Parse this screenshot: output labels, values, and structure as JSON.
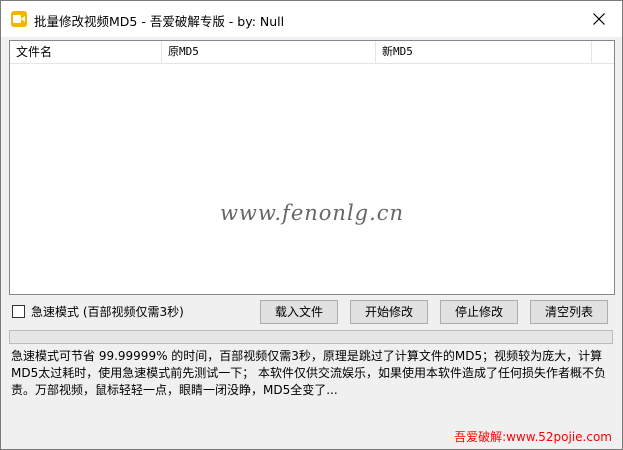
{
  "window": {
    "title": "批量修改视频MD5 - 吾爱破解专版 - by: Null"
  },
  "list": {
    "columns": [
      "文件名",
      "原MD5",
      "新MD5"
    ],
    "rows": []
  },
  "watermark": "www.fenonlg.cn",
  "options": {
    "fast_mode_label": "急速模式 (百部视频仅需3秒)",
    "fast_mode_checked": false
  },
  "buttons": {
    "load": "载入文件",
    "start": "开始修改",
    "stop": "停止修改",
    "clear": "清空列表"
  },
  "progress": {
    "value": 0
  },
  "description": {
    "line1": "急速模式可节省 99.99999% 的时间，百部视频仅需3秒，原理是跳过了计算文件的MD5；视频较为庞大，计算",
    "line2": "MD5太过耗时，使用急速模式前先测试一下；  本软件仅供交流娱乐，如果使用本软件造成了任何损失作者概不负",
    "line3": "责。万部视频，鼠标轻轻一点，眼睛一闭没睁，MD5全变了..."
  },
  "footer": {
    "prefix": "吾爱破解:",
    "url": "www.52pojie.com"
  },
  "colors": {
    "footer_text": "#ff0000",
    "app_icon": "#f5b400",
    "progress_fill": "#06b025"
  }
}
